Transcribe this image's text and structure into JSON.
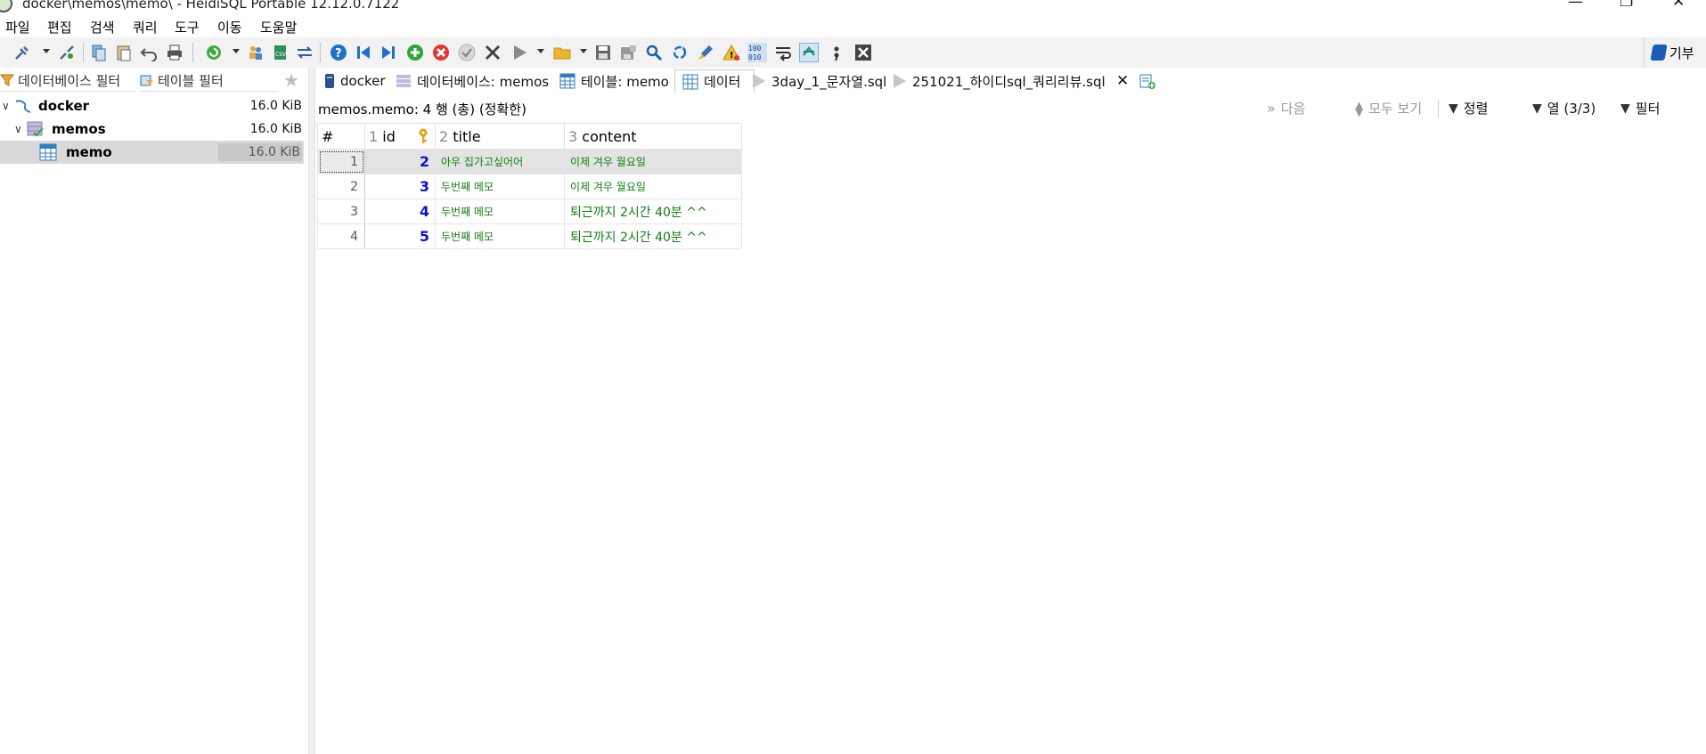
{
  "window": {
    "title": "docker\\memos\\memo\\ - HeidiSQL Portable 12.12.0.7122"
  },
  "menu": [
    "파일",
    "편집",
    "검색",
    "쿼리",
    "도구",
    "이동",
    "도움말"
  ],
  "toolbar": {
    "donate_label": "기부"
  },
  "left": {
    "db_filter_placeholder": "데이터베이스 필터",
    "table_filter_placeholder": "테이블 필터",
    "tree": [
      {
        "name": "docker",
        "size": "16.0 KiB"
      },
      {
        "name": "memos",
        "size": "16.0 KiB"
      },
      {
        "name": "memo",
        "size": "16.0 KiB"
      }
    ]
  },
  "tabs": [
    "docker",
    "데이터베이스: memos",
    "테이블: memo",
    "데이터",
    "3day_1_문자열.sql",
    "251021_하이디sql_쿼리리뷰.sql"
  ],
  "infobar": {
    "info": "memos.memo: 4 행 (총) (정확한)",
    "next": "다음",
    "show_all": "모두 보기",
    "sort": "정렬",
    "columns": "열 (3/3)",
    "filter": "필터"
  },
  "grid": {
    "headers": [
      {
        "num": "#",
        "name": ""
      },
      {
        "num": "1",
        "name": "id"
      },
      {
        "num": "2",
        "name": "title"
      },
      {
        "num": "3",
        "name": "content"
      }
    ],
    "rows": [
      {
        "rn": "1",
        "id": "2",
        "title": "아우 집가고싶어어",
        "content": "이제 겨우 월요일"
      },
      {
        "rn": "2",
        "id": "3",
        "title": "두번째 메모",
        "content": "이제 겨우 월요일"
      },
      {
        "rn": "3",
        "id": "4",
        "title": "두번째 메모",
        "content": "퇴근까지 2시간 40분 ^^"
      },
      {
        "rn": "4",
        "id": "5",
        "title": "두번째 메모",
        "content": "퇴근까지 2시간 40분 ^^"
      }
    ]
  }
}
